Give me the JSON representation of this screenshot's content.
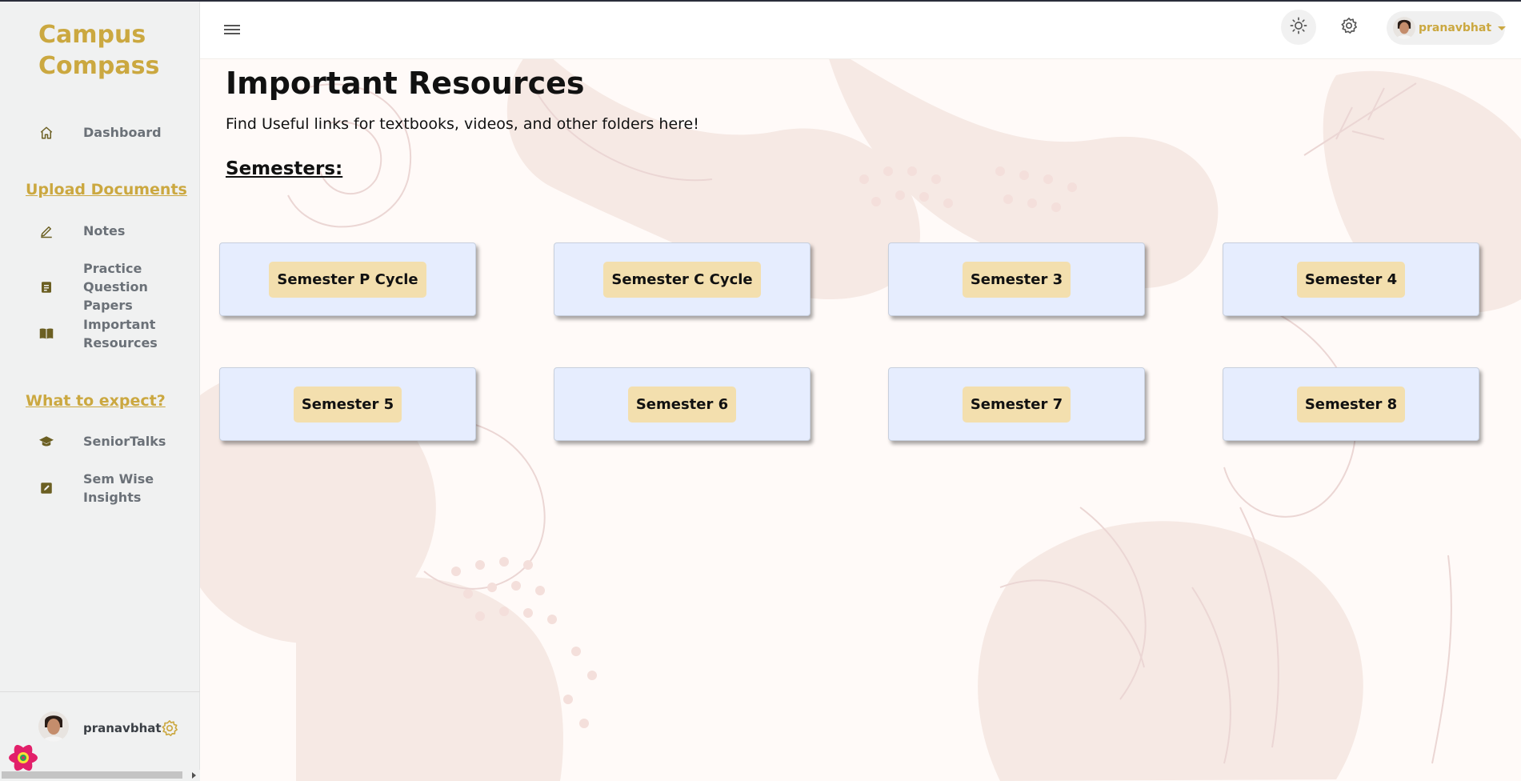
{
  "sidebar": {
    "brand_line1": "Campus",
    "brand_line2": "Compass",
    "dashboard": {
      "label": "Dashboard",
      "icon": "home-icon"
    },
    "upload_section": "Upload Documents",
    "upload_items": [
      {
        "line1": "Notes",
        "line2": "",
        "icon": "pen-icon"
      },
      {
        "line1": "Practice",
        "line2": "Question Papers",
        "icon": "document-icon"
      },
      {
        "line1": "Important",
        "line2": "Resources",
        "icon": "book-icon"
      }
    ],
    "expect_section": "What to expect?",
    "expect_items": [
      {
        "line1": "SeniorTalks",
        "line2": "",
        "icon": "graduation-cap-icon"
      },
      {
        "line1": "Sem Wise",
        "line2": "Insights",
        "icon": "edit-square-icon"
      }
    ],
    "footer": {
      "username": "pranavbhat",
      "icon": "gear-icon"
    }
  },
  "header": {
    "menu_icon": "hamburger-menu-icon",
    "theme_icon": "sun-icon",
    "settings_icon": "gear-icon",
    "username": "pranavbhat",
    "dropdown_icon": "caret-down-icon"
  },
  "main": {
    "title": "Important Resources",
    "subtitle": "Find Useful links for textbooks, videos, and other folders here!",
    "section_heading": "Semesters:",
    "semesters": [
      "Semester P Cycle",
      "Semester C Cycle",
      "Semester 3",
      "Semester 4",
      "Semester 5",
      "Semester 6",
      "Semester 7",
      "Semester 8"
    ]
  },
  "colors": {
    "brand_gold": "#cba840",
    "sidebar_bg": "#f0f1f1",
    "card_bg": "#e6edfe",
    "pill_bg": "#f3dfae",
    "nav_icon": "#6b5f22"
  }
}
